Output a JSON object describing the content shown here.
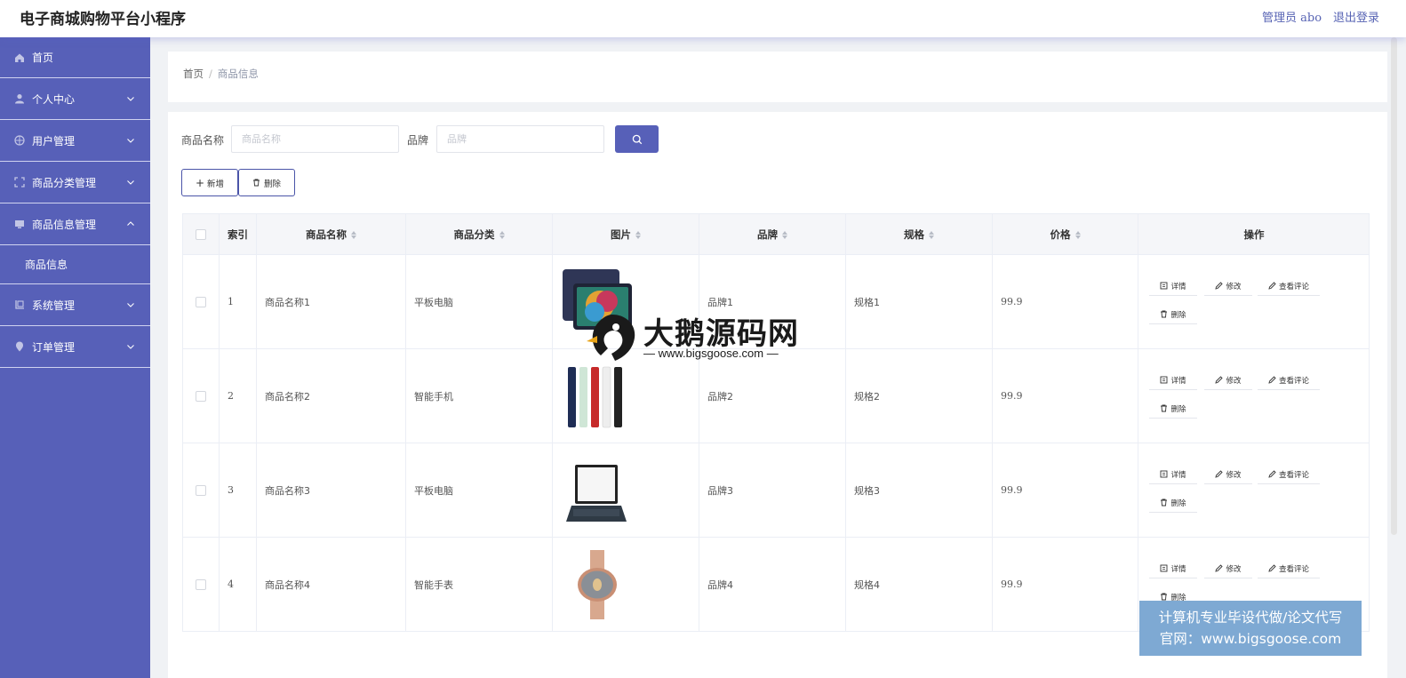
{
  "header": {
    "title": "电子商城购物平台小程序",
    "admin_label": "管理员 abo",
    "logout_label": "退出登录"
  },
  "sidebar": {
    "items": [
      {
        "label": "首页",
        "icon": "home-icon"
      },
      {
        "label": "个人中心",
        "icon": "user-icon"
      },
      {
        "label": "用户管理",
        "icon": "user-manage-icon"
      },
      {
        "label": "商品分类管理",
        "icon": "category-icon"
      },
      {
        "label": "商品信息管理",
        "icon": "product-icon"
      },
      {
        "label": "系统管理",
        "icon": "system-icon"
      },
      {
        "label": "订单管理",
        "icon": "order-icon"
      }
    ],
    "submenu_label": "商品信息"
  },
  "breadcrumb": {
    "home": "首页",
    "current": "商品信息"
  },
  "search": {
    "name_label": "商品名称",
    "name_placeholder": "商品名称",
    "name_value": "",
    "brand_label": "品牌",
    "brand_placeholder": "品牌",
    "brand_value": ""
  },
  "toolbar": {
    "add_label": "新增",
    "delete_label": "删除"
  },
  "table": {
    "columns": [
      "索引",
      "商品名称",
      "商品分类",
      "图片",
      "品牌",
      "规格",
      "价格",
      "操作"
    ],
    "rows": [
      {
        "index": "1",
        "name": "商品名称1",
        "category": "平板电脑",
        "image": "tablet-image",
        "brand": "品牌1",
        "spec": "规格1",
        "price": "99.9"
      },
      {
        "index": "2",
        "name": "商品名称2",
        "category": "智能手机",
        "image": "phones-image",
        "brand": "品牌2",
        "spec": "规格2",
        "price": "99.9"
      },
      {
        "index": "3",
        "name": "商品名称3",
        "category": "平板电脑",
        "image": "laptop-image",
        "brand": "品牌3",
        "spec": "规格3",
        "price": "99.9"
      },
      {
        "index": "4",
        "name": "商品名称4",
        "category": "智能手表",
        "image": "watch-image",
        "brand": "品牌4",
        "spec": "规格4",
        "price": "99.9"
      }
    ],
    "actions": {
      "detail": "详情",
      "edit": "修改",
      "comments": "查看评论",
      "delete": "删除"
    }
  },
  "watermark": {
    "title": "大鹅源码网",
    "url": "— www.bigsgoose.com —"
  },
  "ad_banner": {
    "line1": "计算机专业毕设代做/论文代写",
    "line2": "官网：www.bigsgoose.com"
  },
  "colors": {
    "sidebar": "#5760b8",
    "accent": "#5760b8",
    "ad": "#7ea9d3"
  }
}
